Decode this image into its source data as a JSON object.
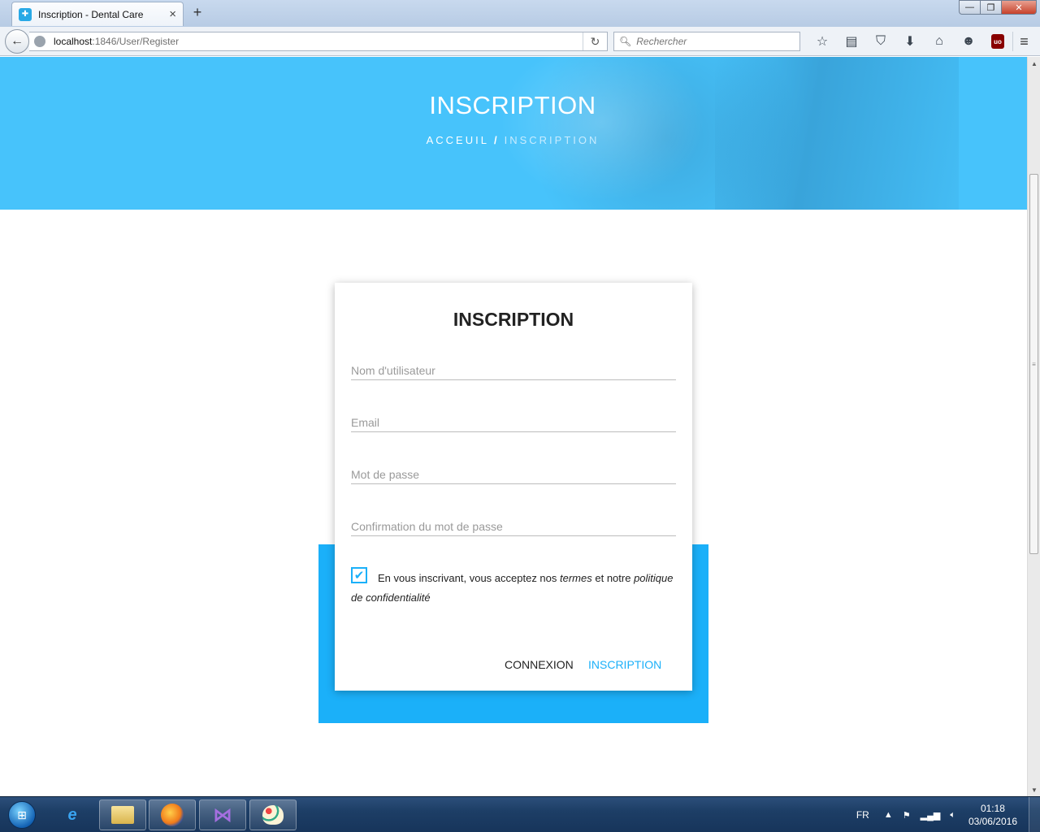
{
  "browser": {
    "tab_title": "Inscription - Dental Care",
    "tab_close": "×",
    "new_tab": "+",
    "url_host": "localhost",
    "url_path": ":1846/User/Register",
    "search_placeholder": "Rechercher",
    "icons": [
      "back-icon",
      "globe-icon",
      "reload-icon",
      "search-icon",
      "bookmark-star-icon",
      "reading-list-icon",
      "pocket-icon",
      "download-icon",
      "home-icon",
      "chat-icon",
      "ublock-icon",
      "hamburger-menu-icon"
    ]
  },
  "window": {
    "minimize": "—",
    "maximize": "❐",
    "close": "✕"
  },
  "hero": {
    "title": "INSCRIPTION",
    "breadcrumb_home": "ACCEUIL",
    "breadcrumb_separator": "/",
    "breadcrumb_current": "INSCRIPTION",
    "background_color": "#47c3fb"
  },
  "form": {
    "title": "INSCRIPTION",
    "username_placeholder": "Nom d'utilisateur",
    "email_placeholder": "Email",
    "password_placeholder": "Mot de passe",
    "confirm_placeholder": "Confirmation du mot de passe",
    "terms_checked": true,
    "terms_text_1": "En vous inscrivant, vous acceptez nos ",
    "terms_link": "termes",
    "terms_text_2": " et notre ",
    "privacy_link": "politique de confidentialité",
    "login_button": "CONNEXION",
    "register_button": "INSCRIPTION",
    "accent_color": "#1bb0f9"
  },
  "taskbar": {
    "language": "FR",
    "time": "01:18",
    "date": "03/06/2016",
    "apps": [
      "start-orb",
      "internet-explorer-icon",
      "file-explorer-icon",
      "firefox-icon",
      "visual-studio-icon",
      "paint-icon"
    ]
  }
}
